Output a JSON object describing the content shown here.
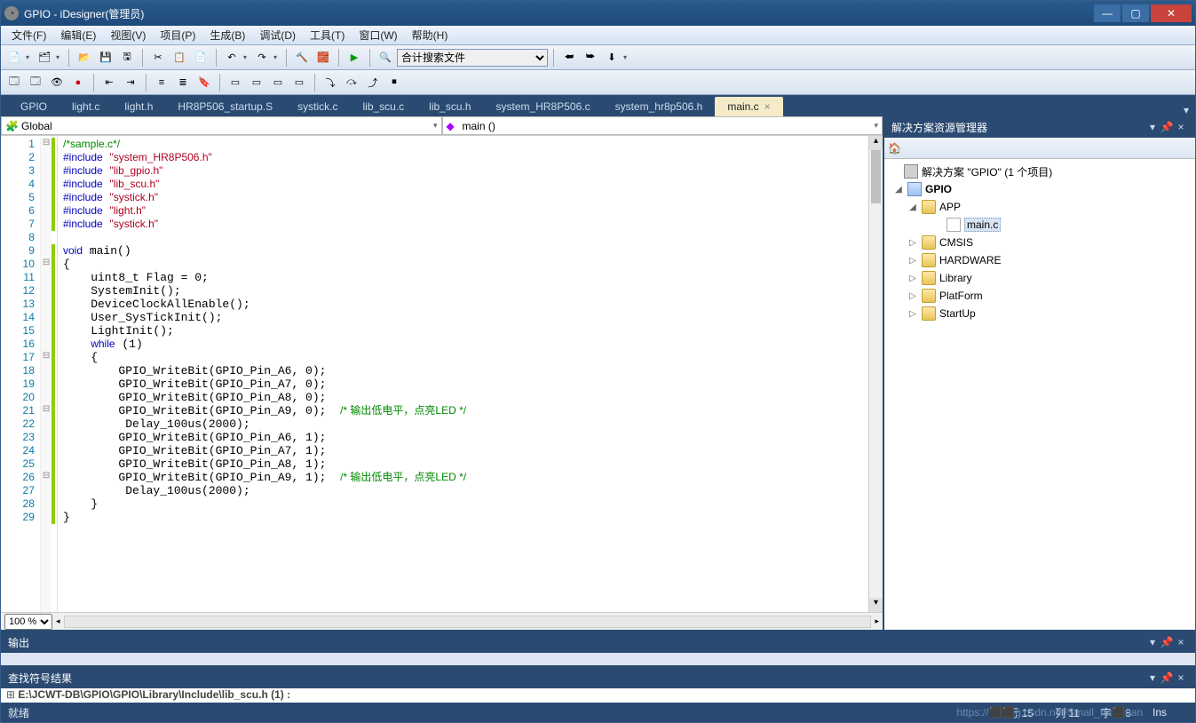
{
  "window": {
    "title": "GPIO - iDesigner(管理员)"
  },
  "menu": [
    "文件(F)",
    "编辑(E)",
    "视图(V)",
    "项目(P)",
    "生成(B)",
    "调试(D)",
    "工具(T)",
    "窗口(W)",
    "帮助(H)"
  ],
  "toolbar1": {
    "search_placeholder": "合计搜索文件"
  },
  "tabs": [
    {
      "label": "GPIO",
      "active": false
    },
    {
      "label": "light.c",
      "active": false
    },
    {
      "label": "light.h",
      "active": false
    },
    {
      "label": "HR8P506_startup.S",
      "active": false
    },
    {
      "label": "systick.c",
      "active": false
    },
    {
      "label": "lib_scu.c",
      "active": false
    },
    {
      "label": "lib_scu.h",
      "active": false
    },
    {
      "label": "system_HR8P506.c",
      "active": false
    },
    {
      "label": "system_hr8p506.h",
      "active": false
    },
    {
      "label": "main.c",
      "active": true
    }
  ],
  "navbar": {
    "scope": "Global",
    "member": "main ()"
  },
  "code_lines": 29,
  "zoom": "100 %",
  "solution": {
    "panel_title": "解决方案资源管理器",
    "root": "解决方案 \"GPIO\" (1 个项目)",
    "project": "GPIO",
    "folders": [
      {
        "name": "APP",
        "expanded": true,
        "children": [
          {
            "name": "main.c",
            "selected": true
          }
        ]
      },
      {
        "name": "CMSIS",
        "expanded": false
      },
      {
        "name": "HARDWARE",
        "expanded": false
      },
      {
        "name": "Library",
        "expanded": false
      },
      {
        "name": "PlatForm",
        "expanded": false
      },
      {
        "name": "StartUp",
        "expanded": false
      }
    ]
  },
  "output": {
    "title": "输出",
    "body": ""
  },
  "find": {
    "title": "查找符号结果",
    "body": "E:\\JCWT-DB\\GPIO\\GPIO\\Library\\Include\\lib_scu.h (1) :"
  },
  "status": {
    "ready": "就绪",
    "line_label": "行",
    "line_val": "15",
    "col_label": "列",
    "col_val": "11",
    "char_label": "字符",
    "char_val": "8",
    "ins": "Ins"
  },
  "watermark": "https://⬛⬛g.csdn.net/Small_fat⬛uan"
}
